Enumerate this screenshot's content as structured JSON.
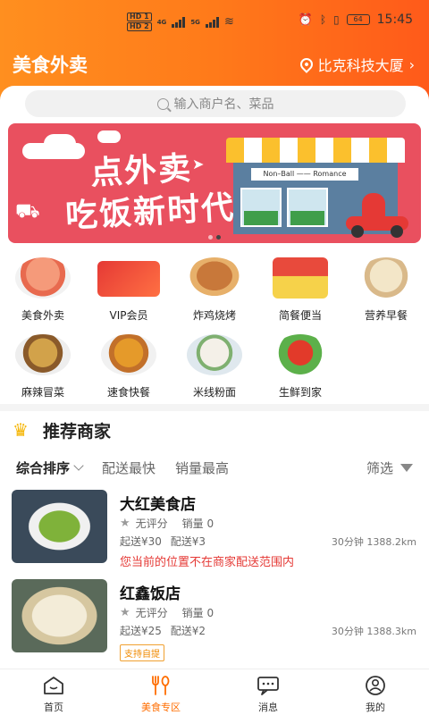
{
  "status_bar": {
    "time": "15:45",
    "battery": "64",
    "hd1": "HD 1",
    "hd2": "HD 2",
    "net1": "4G",
    "net2": "5G"
  },
  "header": {
    "title": "美食外卖",
    "location": "比克科技大厦",
    "accent": "#ff7a1a"
  },
  "search": {
    "placeholder": "输入商户名、菜品"
  },
  "banner": {
    "line1": "点外卖",
    "line2": "吃饭新时代",
    "sign": "Non–Ball —— Romance",
    "dots": 2,
    "active_dot": 1
  },
  "categories": [
    {
      "label": "美食外卖",
      "icon": "covered-dish-icon"
    },
    {
      "label": "VIP会员",
      "icon": "vip-card-icon"
    },
    {
      "label": "炸鸡烧烤",
      "icon": "roast-chicken-icon"
    },
    {
      "label": "简餐便当",
      "icon": "bento-icon"
    },
    {
      "label": "营养早餐",
      "icon": "dumpling-icon"
    },
    {
      "label": "麻辣冒菜",
      "icon": "spicy-bowl-icon"
    },
    {
      "label": "速食快餐",
      "icon": "fast-food-icon"
    },
    {
      "label": "米线粉面",
      "icon": "noodle-bowl-icon"
    },
    {
      "label": "生鲜到家",
      "icon": "fresh-produce-icon"
    }
  ],
  "recommend": {
    "title": "推荐商家",
    "sort": {
      "active": "综合排序",
      "options": [
        "配送最快",
        "销量最高"
      ],
      "filter": "筛选"
    },
    "stores": [
      {
        "name": "大红美食店",
        "rating": "无评分",
        "sales": "销量 0",
        "min_order": "起送¥30",
        "delivery_fee": "配送¥3",
        "time_distance": "30分钟 1388.2km",
        "warning": "您当前的位置不在商家配送范围内"
      },
      {
        "name": "红鑫饭店",
        "rating": "无评分",
        "sales": "销量 0",
        "min_order": "起送¥25",
        "delivery_fee": "配送¥2",
        "time_distance": "30分钟 1388.3km",
        "badge": "支持自提"
      }
    ]
  },
  "tabs": [
    {
      "label": "首页",
      "icon": "home-icon"
    },
    {
      "label": "美食专区",
      "icon": "utensils-icon",
      "active": true
    },
    {
      "label": "消息",
      "icon": "message-icon"
    },
    {
      "label": "我的",
      "icon": "profile-icon"
    }
  ]
}
